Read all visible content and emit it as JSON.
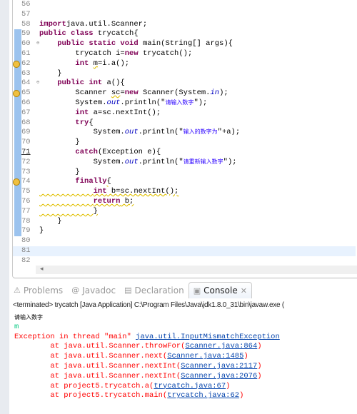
{
  "editor": {
    "lines": [
      {
        "n": "56",
        "t": []
      },
      {
        "n": "57",
        "t": []
      },
      {
        "n": "58",
        "t": [
          [
            "kw",
            "import"
          ],
          [
            "",
            "java.util.Scanner;"
          ]
        ]
      },
      {
        "n": "59",
        "bar": true,
        "t": [
          [
            "kw",
            "public class"
          ],
          [
            "",
            " trycatch{"
          ]
        ]
      },
      {
        "n": "60",
        "bar": true,
        "fold": true,
        "t": [
          [
            "",
            "    "
          ],
          [
            "kw",
            "public static void"
          ],
          [
            "",
            " main(String[] args){"
          ]
        ]
      },
      {
        "n": "61",
        "bar": true,
        "t": [
          [
            "",
            "        trycatch i="
          ],
          [
            "kw",
            "new"
          ],
          [
            "",
            " trycatch();"
          ]
        ]
      },
      {
        "n": "62",
        "bar": true,
        "warn": true,
        "t": [
          [
            "",
            "        "
          ],
          [
            "kw",
            "int"
          ],
          [
            "",
            " "
          ],
          [
            "warn",
            "m"
          ],
          [
            "",
            "=i.a();"
          ]
        ]
      },
      {
        "n": "63",
        "bar": true,
        "t": [
          [
            "",
            "    }"
          ]
        ]
      },
      {
        "n": "64",
        "bar": true,
        "fold": true,
        "t": [
          [
            "",
            "    "
          ],
          [
            "kw",
            "public int"
          ],
          [
            "",
            " a(){"
          ]
        ]
      },
      {
        "n": "65",
        "bar": true,
        "warn": true,
        "t": [
          [
            "",
            "        Scanner "
          ],
          [
            "warn",
            "sc"
          ],
          [
            "",
            "="
          ],
          [
            "kw",
            "new"
          ],
          [
            "",
            " Scanner(System."
          ],
          [
            "fld",
            "in"
          ],
          [
            "",
            ");"
          ]
        ]
      },
      {
        "n": "66",
        "bar": true,
        "t": [
          [
            "",
            "        System."
          ],
          [
            "fld",
            "out"
          ],
          [
            "",
            ".println(\""
          ],
          [
            "str",
            "请输入数字"
          ],
          [
            "",
            "\");"
          ]
        ]
      },
      {
        "n": "67",
        "bar": true,
        "t": [
          [
            "",
            "        "
          ],
          [
            "kw",
            "int"
          ],
          [
            "",
            " a=sc.nextInt();"
          ]
        ]
      },
      {
        "n": "68",
        "bar": true,
        "t": [
          [
            "",
            "        "
          ],
          [
            "kw",
            "try"
          ],
          [
            "",
            "{"
          ]
        ]
      },
      {
        "n": "69",
        "bar": true,
        "t": [
          [
            "",
            "            System."
          ],
          [
            "fld",
            "out"
          ],
          [
            "",
            ".println(\""
          ],
          [
            "str",
            "输入的数字为"
          ],
          [
            "",
            "\"+a);"
          ]
        ]
      },
      {
        "n": "70",
        "bar": true,
        "t": [
          [
            "",
            "        }"
          ]
        ]
      },
      {
        "n": "71",
        "bar": true,
        "u": true,
        "t": [
          [
            "",
            "        "
          ],
          [
            "kw",
            "catch"
          ],
          [
            "",
            "(Exception e){"
          ]
        ]
      },
      {
        "n": "72",
        "bar": true,
        "t": [
          [
            "",
            "            System."
          ],
          [
            "fld",
            "out"
          ],
          [
            "",
            ".println(\""
          ],
          [
            "str",
            "请重新输入数字"
          ],
          [
            "",
            "\");"
          ]
        ]
      },
      {
        "n": "73",
        "bar": true,
        "t": [
          [
            "",
            "        }"
          ]
        ]
      },
      {
        "n": "74",
        "bar": true,
        "warn": true,
        "t": [
          [
            "",
            "        "
          ],
          [
            "kw",
            "finally"
          ],
          [
            "warn",
            "{"
          ]
        ]
      },
      {
        "n": "75",
        "bar": true,
        "t": [
          [
            "warn",
            "            "
          ],
          [
            "kw warn",
            "int"
          ],
          [
            "warn",
            " b=sc.nextInt();"
          ]
        ]
      },
      {
        "n": "76",
        "bar": true,
        "t": [
          [
            "warn",
            "            "
          ],
          [
            "kw warn",
            "return"
          ],
          [
            "warn",
            " b;"
          ]
        ]
      },
      {
        "n": "77",
        "bar": true,
        "t": [
          [
            "warn",
            "            }"
          ]
        ]
      },
      {
        "n": "78",
        "bar": true,
        "t": [
          [
            "",
            "    }"
          ]
        ]
      },
      {
        "n": "79",
        "bar": true,
        "t": [
          [
            "",
            "}"
          ]
        ]
      },
      {
        "n": "80",
        "t": []
      },
      {
        "n": "81",
        "cur": true,
        "t": []
      },
      {
        "n": "82",
        "t": []
      }
    ],
    "scroll_left_icon": "◂"
  },
  "tabs": [
    {
      "label": "Problems",
      "icon": "problems-icon",
      "glyph": "⚠"
    },
    {
      "label": "Javadoc",
      "icon": "javadoc-icon",
      "glyph": "@"
    },
    {
      "label": "Declaration",
      "icon": "declaration-icon",
      "glyph": "▤"
    },
    {
      "label": "Console",
      "icon": "console-icon",
      "glyph": "▣",
      "active": true,
      "close": "✕"
    }
  ],
  "console": {
    "header": "<terminated> trycatch [Java Application] C:\\Program Files\\Java\\jdk1.8.0_31\\bin\\javaw.exe (",
    "output": "请输入数字",
    "input": "m",
    "exception_prefix": "Exception in thread \"main\" ",
    "exception_link": "java.util.InputMismatchException",
    "stack": [
      [
        "        at java.util.Scanner.throwFor(",
        "Scanner.java:864",
        ")"
      ],
      [
        "        at java.util.Scanner.next(",
        "Scanner.java:1485",
        ")"
      ],
      [
        "        at java.util.Scanner.nextInt(",
        "Scanner.java:2117",
        ")"
      ],
      [
        "        at java.util.Scanner.nextInt(",
        "Scanner.java:2076",
        ")"
      ],
      [
        "        at project5.trycatch.a(",
        "trycatch.java:67",
        ")"
      ],
      [
        "        at project5.trycatch.main(",
        "trycatch.java:62",
        ")"
      ]
    ],
    "colors": {
      "error": "#ff0000",
      "link": "#0645ad",
      "input": "#00c87f"
    }
  }
}
